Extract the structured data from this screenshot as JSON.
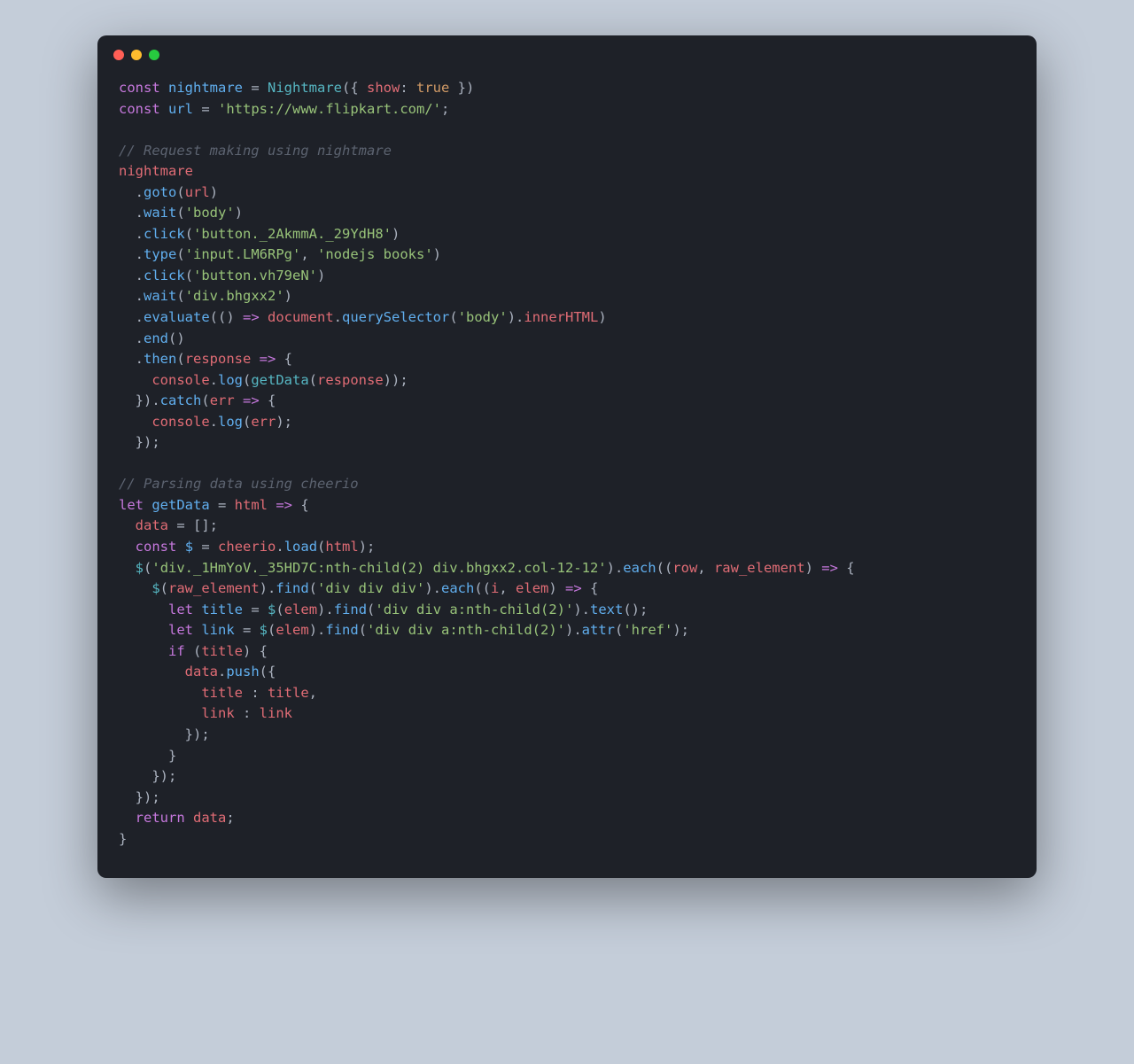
{
  "code": {
    "line1": {
      "const": "const",
      "nightmare": "nightmare",
      "eq": " = ",
      "Nightmare": "Nightmare",
      "paren_open": "({ ",
      "show": "show",
      "colon": ": ",
      "true": "true",
      "paren_close": " })"
    },
    "line2": {
      "const": "const",
      "url": "url",
      "eq": " = ",
      "str": "'https://www.flipkart.com/'",
      "semi": ";"
    },
    "line4": {
      "comment": "// Request making using nightmare"
    },
    "line5": {
      "nightmare": "nightmare"
    },
    "line6": {
      "indent": "  ",
      "dot": ".",
      "goto": "goto",
      "open": "(",
      "url": "url",
      "close": ")"
    },
    "line7": {
      "indent": "  ",
      "dot": ".",
      "wait": "wait",
      "open": "(",
      "str": "'body'",
      "close": ")"
    },
    "line8": {
      "indent": "  ",
      "dot": ".",
      "click": "click",
      "open": "(",
      "str": "'button._2AkmmA._29YdH8'",
      "close": ")"
    },
    "line9": {
      "indent": "  ",
      "dot": ".",
      "type": "type",
      "open": "(",
      "str1": "'input.LM6RPg'",
      "comma": ", ",
      "str2": "'nodejs books'",
      "close": ")"
    },
    "line10": {
      "indent": "  ",
      "dot": ".",
      "click": "click",
      "open": "(",
      "str": "'button.vh79eN'",
      "close": ")"
    },
    "line11": {
      "indent": "  ",
      "dot": ".",
      "wait": "wait",
      "open": "(",
      "str": "'div.bhgxx2'",
      "close": ")"
    },
    "line12": {
      "indent": "  ",
      "dot": ".",
      "evaluate": "evaluate",
      "open": "(() ",
      "arrow": "=>",
      "sp": " ",
      "document": "document",
      "dot2": ".",
      "querySelector": "querySelector",
      "open2": "(",
      "str": "'body'",
      "close2": ").",
      "innerHTML": "innerHTML",
      "close": ")"
    },
    "line13": {
      "indent": "  ",
      "dot": ".",
      "end": "end",
      "parens": "()"
    },
    "line14": {
      "indent": "  ",
      "dot": ".",
      "then": "then",
      "open": "(",
      "response": "response",
      "arrow": " => ",
      "brace": "{"
    },
    "line15": {
      "indent": "    ",
      "console": "console",
      "dot": ".",
      "log": "log",
      "open": "(",
      "getData": "getData",
      "open2": "(",
      "response": "response",
      "close": "));"
    },
    "line16": {
      "indent": "  ",
      "close_brace": "}).",
      "catch": "catch",
      "open": "(",
      "err": "err",
      "arrow": " => ",
      "brace": "{"
    },
    "line17": {
      "indent": "    ",
      "console": "console",
      "dot": ".",
      "log": "log",
      "open": "(",
      "err": "err",
      "close": ");"
    },
    "line18": {
      "indent": "  ",
      "close": "});"
    },
    "line20": {
      "comment": "// Parsing data using cheerio"
    },
    "line21": {
      "let": "let",
      "sp": " ",
      "getData": "getData",
      "eq": " = ",
      "html": "html",
      "arrow": " => ",
      "brace": "{"
    },
    "line22": {
      "indent": "  ",
      "data": "data",
      "rest": " = [];"
    },
    "line23": {
      "indent": "  ",
      "const": "const",
      "sp": " ",
      "dollar": "$",
      "eq": " = ",
      "cheerio": "cheerio",
      "dot": ".",
      "load": "load",
      "open": "(",
      "html": "html",
      "close": ");"
    },
    "line24": {
      "indent": "  ",
      "dollar": "$",
      "open": "(",
      "str": "'div._1HmYoV._35HD7C:nth-child(2) div.bhgxx2.col-12-12'",
      "close": ").",
      "each": "each",
      "open2": "((",
      "row": "row",
      "comma": ", ",
      "raw_element": "raw_element",
      "close2": ") ",
      "arrow": "=>",
      "brace": " {"
    },
    "line25": {
      "indent": "    ",
      "dollar": "$",
      "open": "(",
      "raw_element": "raw_element",
      "close": ").",
      "find": "find",
      "open2": "(",
      "str": "'div div div'",
      "close2": ").",
      "each": "each",
      "open3": "((",
      "i": "i",
      "comma": ", ",
      "elem": "elem",
      "close3": ") ",
      "arrow": "=>",
      "brace": " {"
    },
    "line26": {
      "indent": "      ",
      "let": "let",
      "sp": " ",
      "title": "title",
      "eq": " = ",
      "dollar": "$",
      "open": "(",
      "elem": "elem",
      "close": ").",
      "find": "find",
      "open2": "(",
      "str": "'div div a:nth-child(2)'",
      "close2": ").",
      "text": "text",
      "parens": "();"
    },
    "line27": {
      "indent": "      ",
      "let": "let",
      "sp": " ",
      "link": "link",
      "eq": " = ",
      "dollar": "$",
      "open": "(",
      "elem": "elem",
      "close": ").",
      "find": "find",
      "open2": "(",
      "str": "'div div a:nth-child(2)'",
      "close2": ").",
      "attr": "attr",
      "open3": "(",
      "str2": "'href'",
      "close3": ");"
    },
    "line28": {
      "indent": "      ",
      "if": "if",
      "sp": " (",
      "title": "title",
      "close": ") {"
    },
    "line29": {
      "indent": "        ",
      "data": "data",
      "dot": ".",
      "push": "push",
      "open": "({"
    },
    "line30": {
      "indent": "          ",
      "title": "title",
      "colon": " : ",
      "title2": "title",
      "comma": ","
    },
    "line31": {
      "indent": "          ",
      "link": "link",
      "colon": " : ",
      "link2": "link"
    },
    "line32": {
      "indent": "        ",
      "close": "});"
    },
    "line33": {
      "indent": "      ",
      "close": "}"
    },
    "line34": {
      "indent": "    ",
      "close": "});"
    },
    "line35": {
      "indent": "  ",
      "close": "});"
    },
    "line36": {
      "indent": "  ",
      "return": "return",
      "sp": " ",
      "data": "data",
      "semi": ";"
    },
    "line37": {
      "close": "}"
    }
  }
}
